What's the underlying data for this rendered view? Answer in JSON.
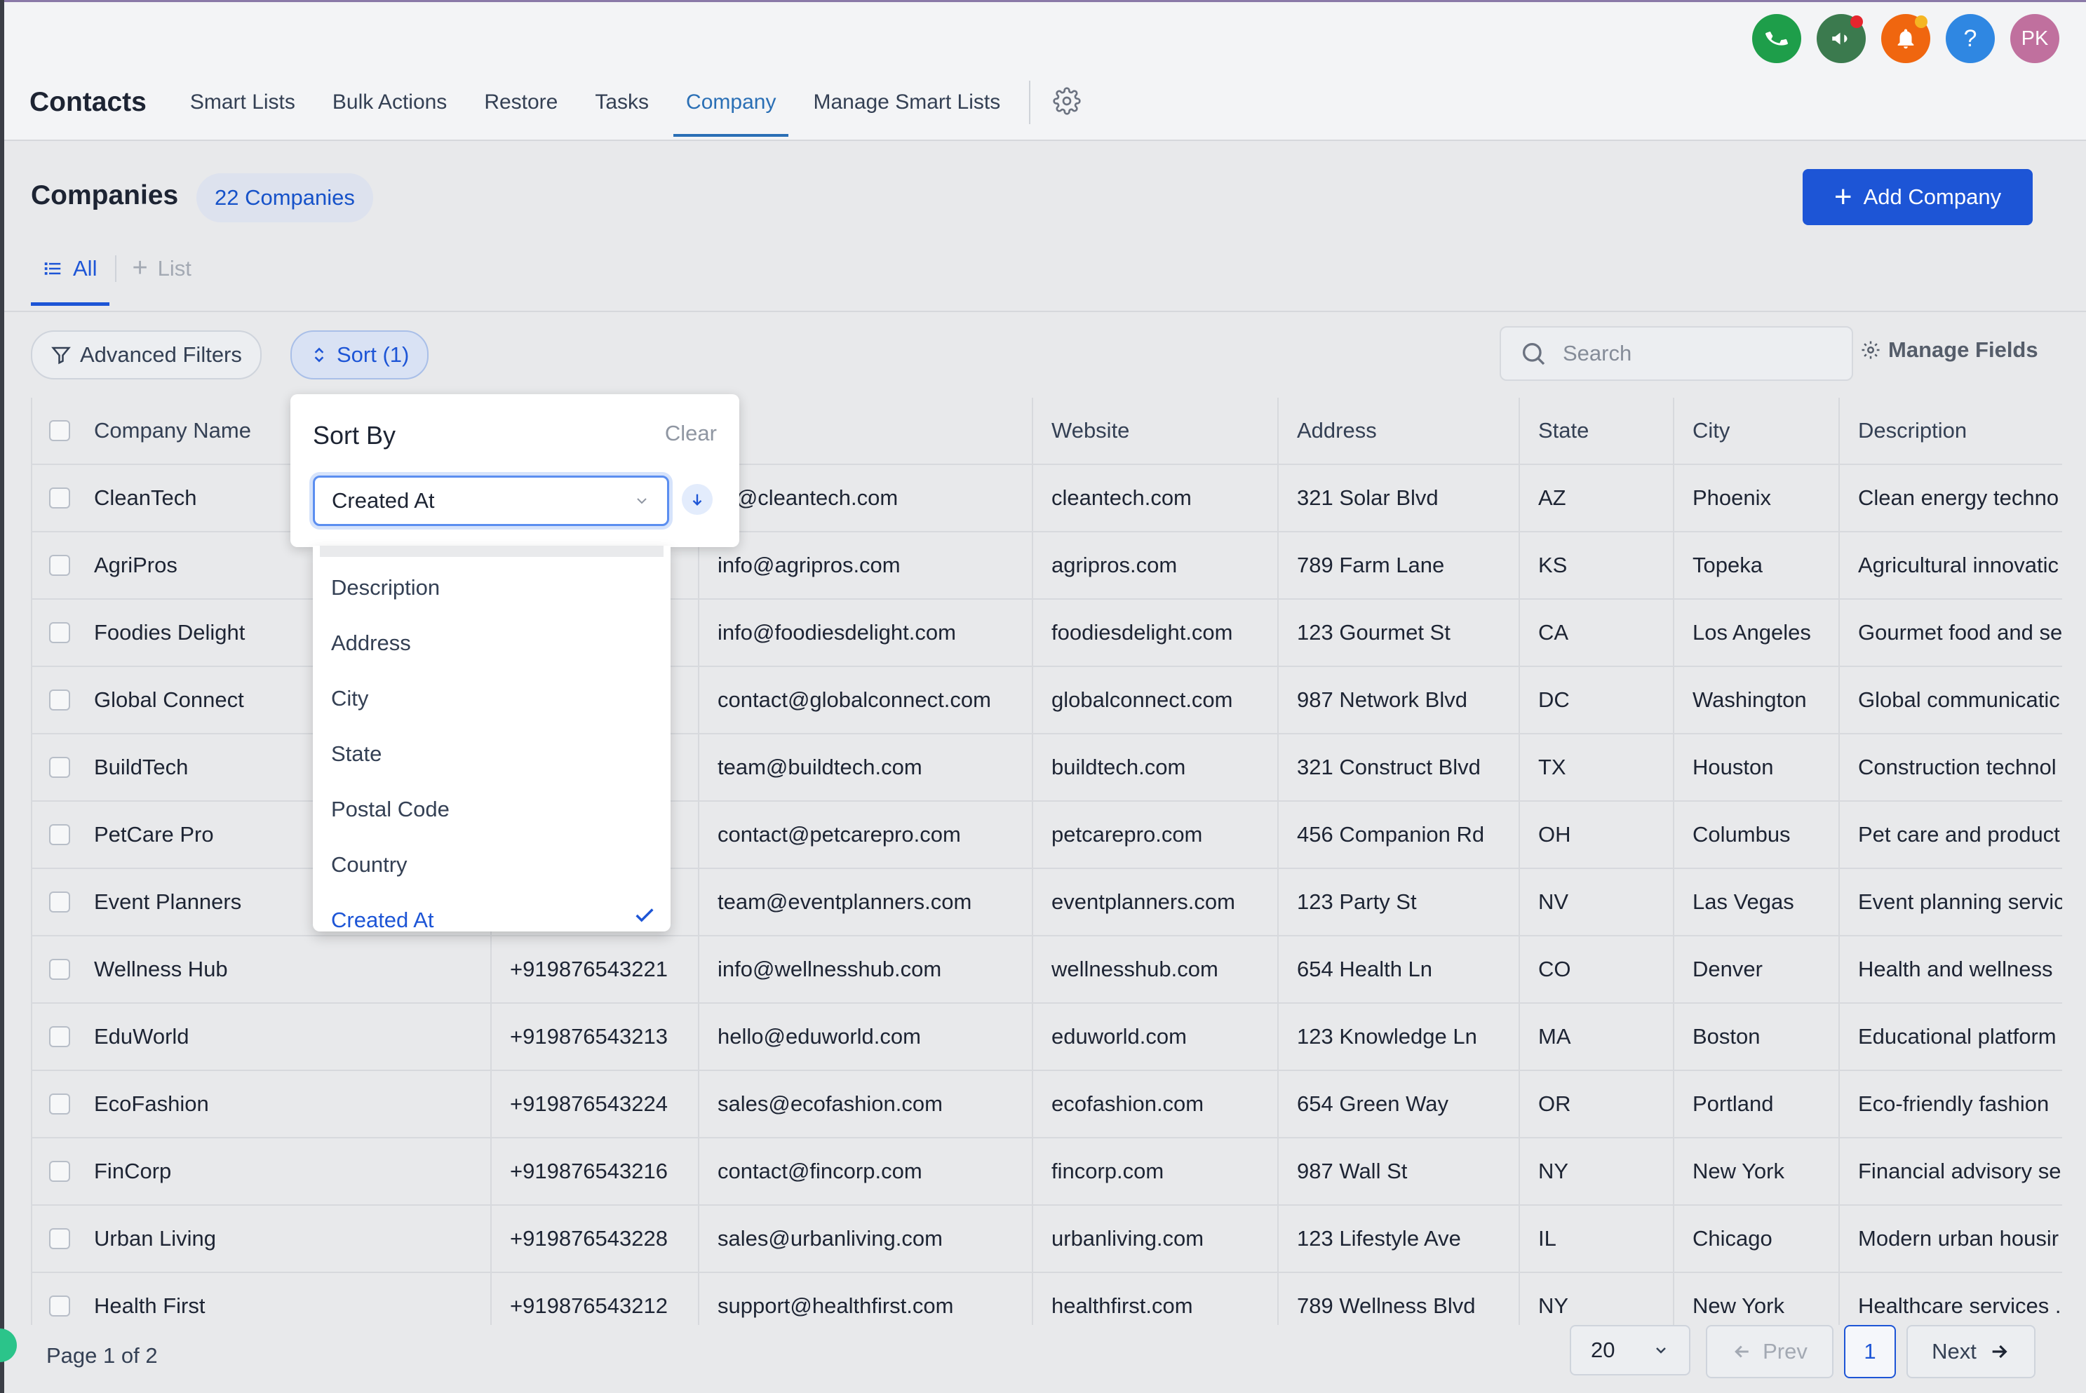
{
  "header": {
    "brand": "Contacts",
    "nav": [
      "Smart Lists",
      "Bulk Actions",
      "Restore",
      "Tasks",
      "Company",
      "Manage Smart Lists"
    ],
    "active_nav": "Company",
    "avatar_initials": "PK"
  },
  "page": {
    "title": "Companies",
    "count_badge": "22 Companies",
    "add_button": "Add Company",
    "tab_all": "All",
    "tab_list": "List"
  },
  "toolbar": {
    "advanced_filters": "Advanced Filters",
    "sort": "Sort (1)",
    "search_placeholder": "Search",
    "manage_fields": "Manage Fields"
  },
  "sort_panel": {
    "title": "Sort By",
    "clear": "Clear",
    "selected": "Created At",
    "options": [
      "Description",
      "Address",
      "City",
      "State",
      "Postal Code",
      "Country",
      "Created At"
    ]
  },
  "table": {
    "columns": [
      "Company Name",
      "",
      "ail",
      "Website",
      "Address",
      "State",
      "City",
      "Description"
    ],
    "rows": [
      {
        "name": "CleanTech",
        "phone": "",
        "email": "m@cleantech.com",
        "website": "cleantech.com",
        "address": "321 Solar Blvd",
        "state": "AZ",
        "city": "Phoenix",
        "description": "Clean energy techno"
      },
      {
        "name": "AgriPros",
        "phone": "",
        "email": "info@agripros.com",
        "website": "agripros.com",
        "address": "789 Farm Lane",
        "state": "KS",
        "city": "Topeka",
        "description": "Agricultural innovatic"
      },
      {
        "name": "Foodies Delight",
        "phone": "",
        "email": "info@foodiesdelight.com",
        "website": "foodiesdelight.com",
        "address": "123 Gourmet St",
        "state": "CA",
        "city": "Los Angeles",
        "description": "Gourmet food and se"
      },
      {
        "name": "Global Connect",
        "phone": "",
        "email": "contact@globalconnect.com",
        "website": "globalconnect.com",
        "address": "987 Network Blvd",
        "state": "DC",
        "city": "Washington",
        "description": "Global communicatic"
      },
      {
        "name": "BuildTech",
        "phone": "",
        "email": "team@buildtech.com",
        "website": "buildtech.com",
        "address": "321 Construct Blvd",
        "state": "TX",
        "city": "Houston",
        "description": "Construction technol"
      },
      {
        "name": "PetCare Pro",
        "phone": "",
        "email": "contact@petcarepro.com",
        "website": "petcarepro.com",
        "address": "456 Companion Rd",
        "state": "OH",
        "city": "Columbus",
        "description": "Pet care and product"
      },
      {
        "name": "Event Planners",
        "phone": "",
        "email": "team@eventplanners.com",
        "website": "eventplanners.com",
        "address": "123 Party St",
        "state": "NV",
        "city": "Las Vegas",
        "description": "Event planning servic"
      },
      {
        "name": "Wellness Hub",
        "phone": "+919876543221",
        "email": "info@wellnesshub.com",
        "website": "wellnesshub.com",
        "address": "654 Health Ln",
        "state": "CO",
        "city": "Denver",
        "description": "Health and wellness"
      },
      {
        "name": "EduWorld",
        "phone": "+919876543213",
        "email": "hello@eduworld.com",
        "website": "eduworld.com",
        "address": "123 Knowledge Ln",
        "state": "MA",
        "city": "Boston",
        "description": "Educational platform"
      },
      {
        "name": "EcoFashion",
        "phone": "+919876543224",
        "email": "sales@ecofashion.com",
        "website": "ecofashion.com",
        "address": "654 Green Way",
        "state": "OR",
        "city": "Portland",
        "description": "Eco-friendly fashion"
      },
      {
        "name": "FinCorp",
        "phone": "+919876543216",
        "email": "contact@fincorp.com",
        "website": "fincorp.com",
        "address": "987 Wall St",
        "state": "NY",
        "city": "New York",
        "description": "Financial advisory se"
      },
      {
        "name": "Urban Living",
        "phone": "+919876543228",
        "email": "sales@urbanliving.com",
        "website": "urbanliving.com",
        "address": "123 Lifestyle Ave",
        "state": "IL",
        "city": "Chicago",
        "description": "Modern urban housir"
      },
      {
        "name": "Health First",
        "phone": "+919876543212",
        "email": "support@healthfirst.com",
        "website": "healthfirst.com",
        "address": "789 Wellness Blvd",
        "state": "NY",
        "city": "New York",
        "description": "Healthcare services ."
      }
    ]
  },
  "footer": {
    "page_info": "Page 1 of 2",
    "page_size": "20",
    "prev": "Prev",
    "current_page": "1",
    "next": "Next"
  },
  "colors": {
    "accent": "#1d55d6",
    "phone_icon": "#1e9e4a",
    "announce_icon": "#3b7a4e",
    "bell_icon": "#f0660f",
    "help_icon": "#2f87e2",
    "avatar": "#c0709e"
  }
}
